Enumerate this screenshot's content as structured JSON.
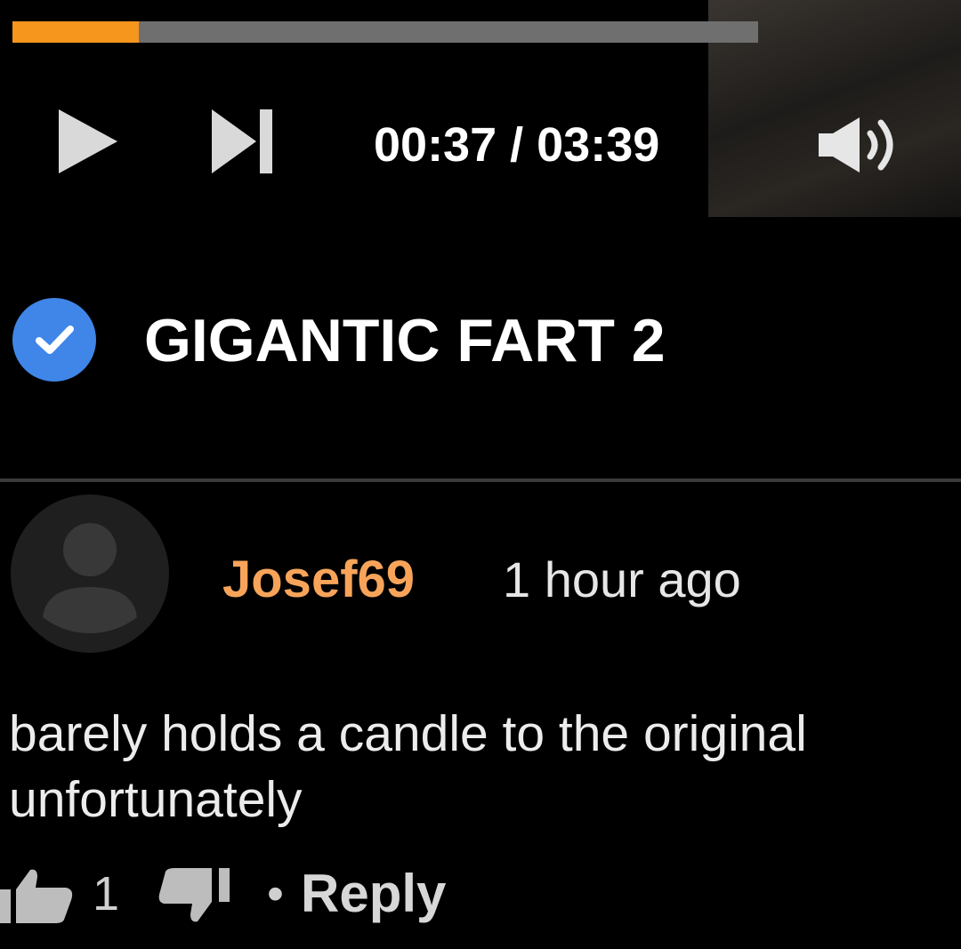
{
  "player": {
    "progress_fraction": 0.1689,
    "progress_color": "#f7961c",
    "track_color": "#6f6f6f",
    "current_time": "00:37",
    "duration": "03:39",
    "time_separator": " / ",
    "icons": {
      "play": "play-icon",
      "next": "skip-next-icon",
      "volume": "volume-icon"
    }
  },
  "video": {
    "title": "GIGANTIC FART 2",
    "verified_icon": "verified-check-icon",
    "verified_color": "#3f86e8"
  },
  "comment": {
    "author": "Josef69",
    "author_color": "#f7a45a",
    "timestamp": "1 hour ago",
    "avatar_icon": "default-avatar-icon",
    "body": "barely holds a candle to the original unfortunately",
    "likes": "1",
    "separator": "•",
    "reply_label": "Reply",
    "icons": {
      "like": "thumbs-up-icon",
      "dislike": "thumbs-down-icon"
    }
  }
}
